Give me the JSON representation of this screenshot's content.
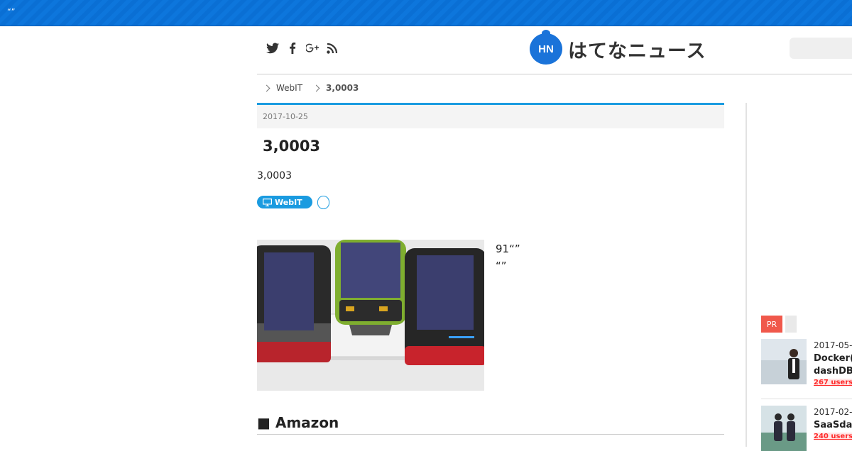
{
  "topbar": {
    "text": "“”"
  },
  "social": {
    "icons": [
      "twitter-icon",
      "facebook-icon",
      "google-plus-icon",
      "rss-icon"
    ]
  },
  "logo": {
    "badge": "HN",
    "text": "はてなニュース"
  },
  "breadcrumb": {
    "category": "WebIT",
    "current": "3,0003"
  },
  "article": {
    "date": "2017-10-25",
    "title": "3,0003",
    "subtitle": "3,0003",
    "tag": "WebIT",
    "description_line1": "91“”",
    "description_line2": "“”",
    "section_heading": "■ Amazon"
  },
  "sidebar": {
    "pr_label": "PR",
    "items": [
      {
        "date": "2017-05-",
        "title_line1": "Docker(",
        "title_line2": "dashDB",
        "users": "267 users"
      },
      {
        "date": "2017-02-",
        "title_line1": "SaaSda",
        "users": "240 users"
      }
    ]
  },
  "colors": {
    "brand_blue": "#1a73d9",
    "accent_cyan": "#1a9be0",
    "pr_red": "#f0584b",
    "users_red": "#ff2a2a"
  }
}
